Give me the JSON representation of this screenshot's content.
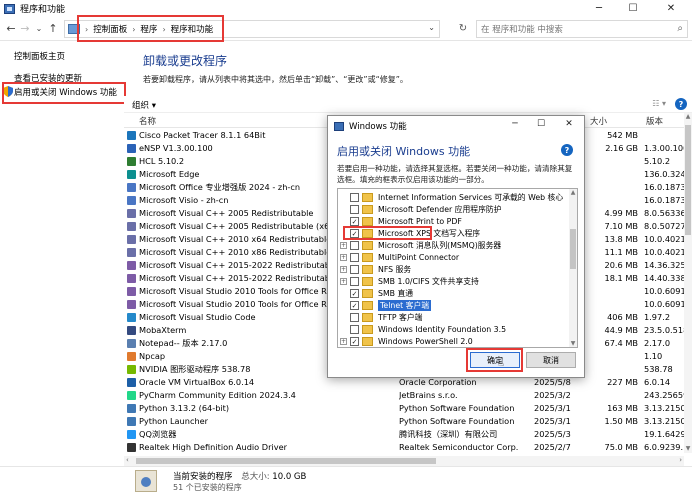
{
  "window": {
    "title": "程序和功能",
    "min": "─",
    "max": "☐",
    "close": "✕"
  },
  "nav": {
    "back": "←",
    "forward": "→",
    "recent": "⌄",
    "up": "↑",
    "breadcrumb": [
      "控制面板",
      "程序",
      "程序和功能"
    ],
    "crumb_sep": "›",
    "dropdown": "⌄",
    "refresh": "↻",
    "search_placeholder": "在 程序和功能 中搜索",
    "search_icon": "⌕"
  },
  "sidebar": {
    "items": [
      {
        "label": "控制面板主页"
      },
      {
        "label": "查看已安装的更新"
      },
      {
        "label": "启用或关闭 Windows 功能"
      }
    ]
  },
  "main": {
    "heading": "卸载或更改程序",
    "subtitle": "若要卸载程序，请从列表中将其选中，然后单击“卸载”、“更改”或“修复”。"
  },
  "toolbar": {
    "organize": "组织 ▾",
    "view": "☷ ▾",
    "help": "?"
  },
  "columns": {
    "name": "名称",
    "size": "大小",
    "version": "版本"
  },
  "programs": [
    {
      "name": "Cisco Packet Tracer 8.1.1 64Bit",
      "publisher": "",
      "date": "",
      "size": "542 MB",
      "version": "",
      "color": "#1b75bb"
    },
    {
      "name": "eNSP V1.3.00.100",
      "publisher": "",
      "date": "",
      "size": "2.16 GB",
      "version": "1.3.00.100",
      "color": "#2a62b7"
    },
    {
      "name": "HCL 5.10.2",
      "publisher": "",
      "date": "",
      "size": "",
      "version": "5.10.2",
      "color": "#2e7d32"
    },
    {
      "name": "Microsoft Edge",
      "publisher": "",
      "date": "",
      "size": "",
      "version": "136.0.3240",
      "color": "#0c8f8f"
    },
    {
      "name": "Microsoft Office 专业增强版 2024 - zh-cn",
      "publisher": "",
      "date": "",
      "size": "",
      "version": "16.0.18730",
      "color": "#4a76c4"
    },
    {
      "name": "Microsoft Visio - zh-cn",
      "publisher": "",
      "date": "",
      "size": "",
      "version": "16.0.18730",
      "color": "#4a76c4"
    },
    {
      "name": "Microsoft Visual C++ 2005 Redistributable",
      "publisher": "",
      "date": "",
      "size": "4.99 MB",
      "version": "8.0.56336",
      "color": "#6a6fa8"
    },
    {
      "name": "Microsoft Visual C++ 2005 Redistributable (x64)",
      "publisher": "",
      "date": "",
      "size": "7.10 MB",
      "version": "8.0.50727.4",
      "color": "#6a6fa8"
    },
    {
      "name": "Microsoft Visual C++ 2010  x64 Redistributable - 10.",
      "publisher": "",
      "date": "",
      "size": "13.8 MB",
      "version": "10.0.40219",
      "color": "#6a6fa8"
    },
    {
      "name": "Microsoft Visual C++ 2010  x86 Redistributable - 10.",
      "publisher": "",
      "date": "",
      "size": "11.1 MB",
      "version": "10.0.40219",
      "color": "#6a6fa8"
    },
    {
      "name": "Microsoft Visual C++ 2015-2022 Redistributable (x6",
      "publisher": "",
      "date": "",
      "size": "20.6 MB",
      "version": "14.36.3253",
      "color": "#7d5ba6"
    },
    {
      "name": "Microsoft Visual C++ 2015-2022 Redistributable (x8",
      "publisher": "",
      "date": "",
      "size": "18.1 MB",
      "version": "14.40.3381",
      "color": "#7d5ba6"
    },
    {
      "name": "Microsoft Visual Studio 2010 Tools for Office Runtim",
      "publisher": "",
      "date": "",
      "size": "",
      "version": "10.0.60917",
      "color": "#7d5ba6"
    },
    {
      "name": "Microsoft Visual Studio 2010 Tools for Office Runtim",
      "publisher": "",
      "date": "",
      "size": "",
      "version": "10.0.60917",
      "color": "#7d5ba6"
    },
    {
      "name": "Microsoft Visual Studio Code",
      "publisher": "",
      "date": "",
      "size": "406 MB",
      "version": "1.97.2",
      "color": "#2489ca"
    },
    {
      "name": "MobaXterm",
      "publisher": "",
      "date": "",
      "size": "44.9 MB",
      "version": "23.5.0.5182",
      "color": "#344a80"
    },
    {
      "name": "Notepad-- 版本 2.17.0",
      "publisher": "",
      "date": "",
      "size": "67.4 MB",
      "version": "2.17.0",
      "color": "#5a7fb0"
    },
    {
      "name": "Npcap",
      "publisher": "",
      "date": "",
      "size": "",
      "version": "1.10",
      "color": "#e07a2e"
    },
    {
      "name": "NVIDIA 图形驱动程序 538.78",
      "publisher": "",
      "date": "",
      "size": "",
      "version": "538.78",
      "color": "#76b900"
    },
    {
      "name": "Oracle VM VirtualBox 6.0.14",
      "publisher": "Oracle Corporation",
      "date": "2025/5/8",
      "size": "227 MB",
      "version": "6.0.14",
      "color": "#1d5fa7"
    },
    {
      "name": "PyCharm Community Edition 2024.3.4",
      "publisher": "JetBrains s.r.o.",
      "date": "2025/3/2",
      "size": "",
      "version": "243.25659.",
      "color": "#21d789"
    },
    {
      "name": "Python 3.13.2 (64-bit)",
      "publisher": "Python Software Foundation",
      "date": "2025/3/1",
      "size": "163 MB",
      "version": "3.13.2150.0",
      "color": "#3f78b4"
    },
    {
      "name": "Python Launcher",
      "publisher": "Python Software Foundation",
      "date": "2025/3/1",
      "size": "1.50 MB",
      "version": "3.13.2150.0",
      "color": "#3f78b4"
    },
    {
      "name": "QQ浏览器",
      "publisher": "腾讯科技（深圳）有限公司",
      "date": "2025/5/3",
      "size": "",
      "version": "19.1.6429.4",
      "color": "#2196f3"
    },
    {
      "name": "Realtek High Definition Audio Driver",
      "publisher": "Realtek Semiconductor Corp.",
      "date": "2025/2/7",
      "size": "75.0 MB",
      "version": "6.0.9239.1",
      "color": "#333333"
    }
  ],
  "scroll": {
    "up": "▲",
    "down": "▼",
    "left": "‹",
    "right": "›"
  },
  "status": {
    "current": "当前安装的程序",
    "total_label": "总大小:",
    "total_size": "10.0 GB",
    "count": "51 个已安装的程序"
  },
  "dialog": {
    "title": "Windows 功能",
    "min": "─",
    "max": "☐",
    "close": "✕",
    "heading": "启用或关闭 Windows 功能",
    "help": "?",
    "description": "若要启用一种功能，请选择其复选框。若要关闭一种功能，请清除其复选框。填充的框表示仅启用该功能的一部分。",
    "features": [
      {
        "label": "Internet Information Services 可承载的 Web 核心",
        "expand": "",
        "state": "unchecked"
      },
      {
        "label": "Microsoft Defender 应用程序防护",
        "expand": "",
        "state": "unchecked"
      },
      {
        "label": "Microsoft Print to PDF",
        "expand": "",
        "state": "checked"
      },
      {
        "label": "Microsoft XPS 文档写入程序",
        "expand": "",
        "state": "checked"
      },
      {
        "label": "Microsoft 消息队列(MSMQ)服务器",
        "expand": "+",
        "state": "unchecked"
      },
      {
        "label": "MultiPoint Connector",
        "expand": "+",
        "state": "unchecked"
      },
      {
        "label": "NFS 服务",
        "expand": "+",
        "state": "unchecked"
      },
      {
        "label": "SMB 1.0/CIFS 文件共享支持",
        "expand": "+",
        "state": "unchecked"
      },
      {
        "label": "SMB 直通",
        "expand": "",
        "state": "checked"
      },
      {
        "label": "Telnet 客户端",
        "expand": "",
        "state": "checked",
        "selected": true
      },
      {
        "label": "TFTP 客户端",
        "expand": "",
        "state": "unchecked"
      },
      {
        "label": "Windows Identity Foundation 3.5",
        "expand": "",
        "state": "unchecked"
      },
      {
        "label": "Windows PowerShell 2.0",
        "expand": "+",
        "state": "checked"
      }
    ],
    "ok": "确定",
    "cancel": "取消",
    "check_mark": "✓"
  }
}
